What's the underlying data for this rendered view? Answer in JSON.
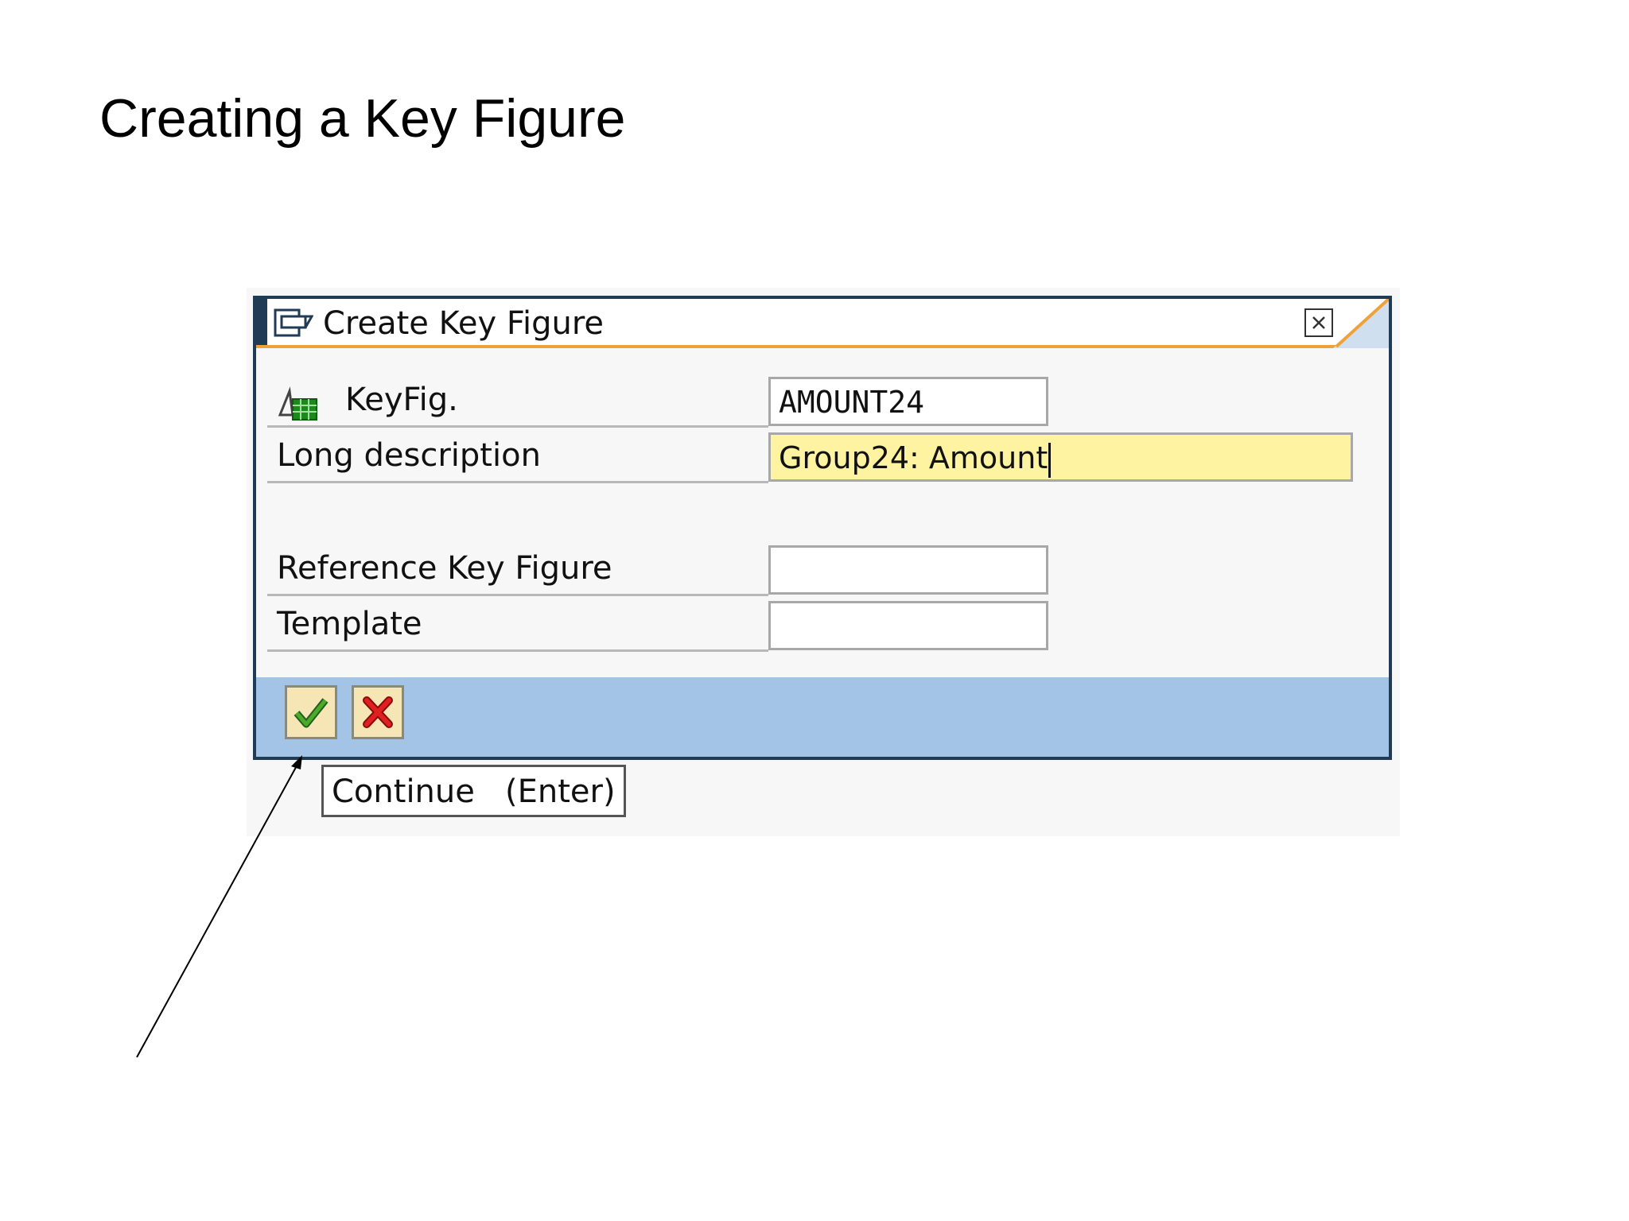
{
  "slide": {
    "title": "Creating a Key Figure"
  },
  "dialog": {
    "title": "Create Key Figure",
    "close_icon": "close-icon"
  },
  "form": {
    "keyfig": {
      "label": "KeyFig.",
      "value": "AMOUNT24"
    },
    "long_description": {
      "label": "Long description",
      "value": "Group24: Amount"
    },
    "reference_key_figure": {
      "label": "Reference Key Figure",
      "value": ""
    },
    "template": {
      "label": "Template",
      "value": ""
    }
  },
  "toolbar": {
    "continue_icon": "checkmark-icon",
    "cancel_icon": "cancel-x-icon"
  },
  "tooltip": {
    "text": "Continue   (Enter)"
  },
  "colors": {
    "frame": "#1f3b55",
    "title_underline": "#f0a23a",
    "toolbar": "#a3c4e6",
    "active_field": "#fdf3a0",
    "button_face": "#f6e6b5"
  }
}
